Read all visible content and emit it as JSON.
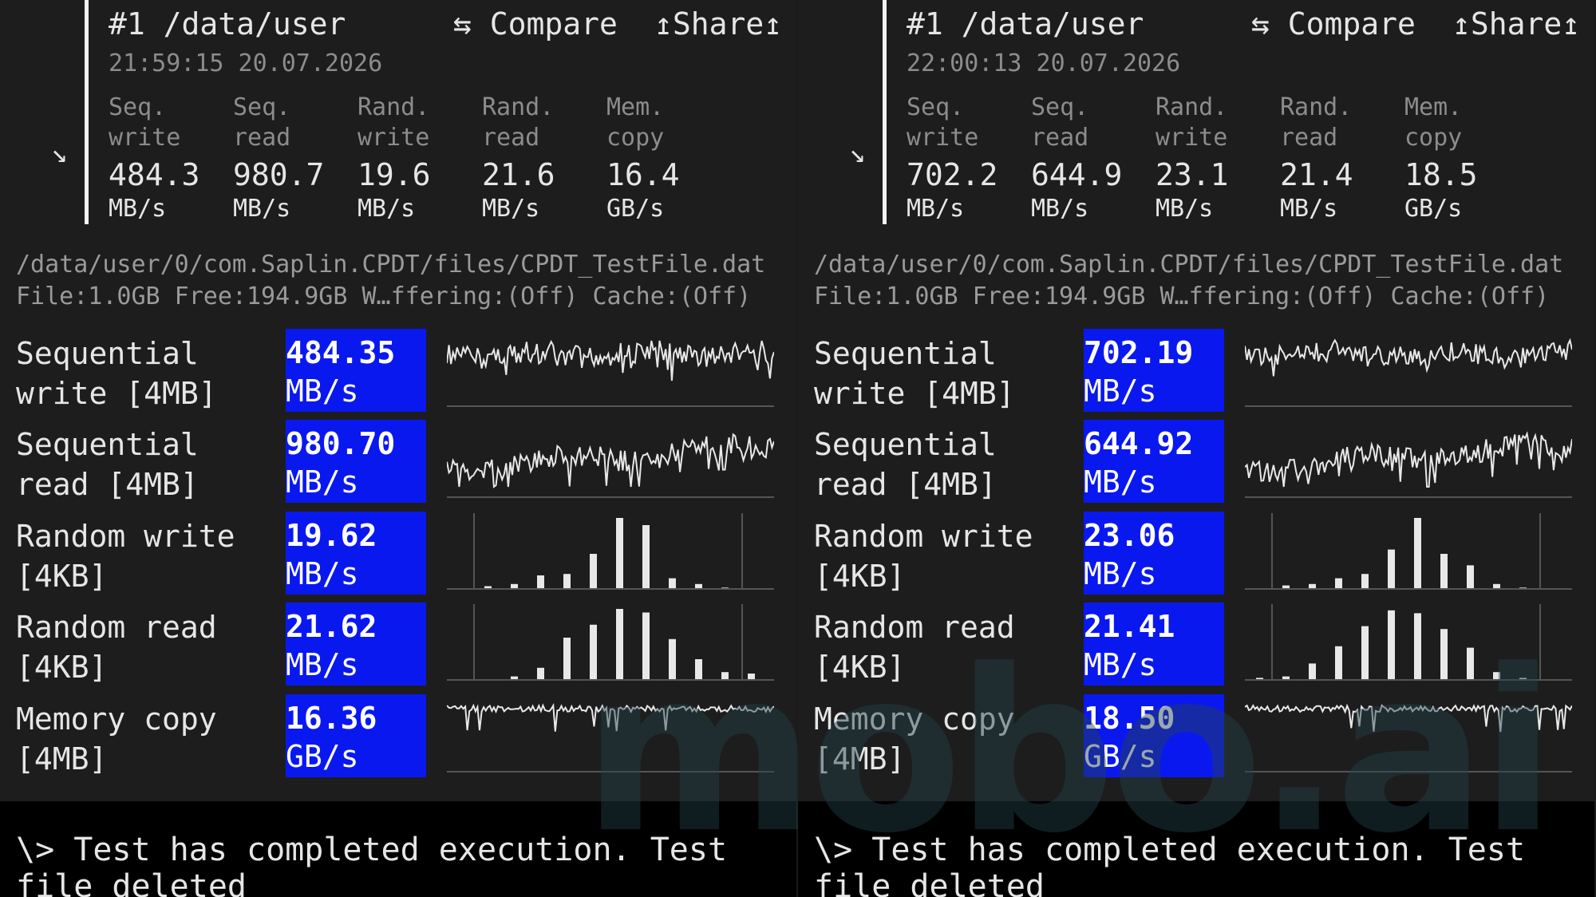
{
  "colors": {
    "value_box": "#0a18f0",
    "background": "#1d1d1d",
    "status_background": "#000000"
  },
  "icons": {
    "arrow": "arrow-down-right-icon",
    "compare": "swap-icon",
    "share": "share-icon"
  },
  "watermark": "mobo.ai",
  "panels": [
    {
      "title": "#1 /data/user",
      "compare_label": "⇆ Compare",
      "share_label": "↥Share↥",
      "timestamp": "21:59:15 20.07.2026",
      "arrow": "↘",
      "metrics": [
        {
          "l1": "Seq.",
          "l2": "write",
          "value": "484.3",
          "unit": "MB/s"
        },
        {
          "l1": "Seq.",
          "l2": "read",
          "value": "980.7",
          "unit": "MB/s"
        },
        {
          "l1": "Rand.",
          "l2": "write",
          "value": "19.6",
          "unit": "MB/s"
        },
        {
          "l1": "Rand.",
          "l2": "read",
          "value": "21.6",
          "unit": "MB/s"
        },
        {
          "l1": "Mem.",
          "l2": "copy",
          "value": "16.4",
          "unit": "GB/s"
        }
      ],
      "path": "/data/user/0/com.Saplin.CPDT/files/CPDT_TestFile.dat",
      "info": "File:1.0GB Free:194.9GB W…ffering:(Off) Cache:(Off)",
      "results": [
        {
          "label": "Sequential\nwrite [4MB]",
          "value": "484.35",
          "unit": "MB/s",
          "graph": "line"
        },
        {
          "label": "Sequential\nread [4MB]",
          "value": "980.70",
          "unit": "MB/s",
          "graph": "line"
        },
        {
          "label": "Random write\n[4KB]",
          "value": "19.62",
          "unit": "MB/s",
          "graph": "bars"
        },
        {
          "label": "Random read\n[4KB]",
          "value": "21.62",
          "unit": "MB/s",
          "graph": "bars"
        },
        {
          "label": "Memory copy\n[4MB]",
          "value": "16.36",
          "unit": "GB/s",
          "graph": "line"
        }
      ],
      "status": "\\> Test has completed execution. Test file deleted"
    },
    {
      "title": "#1 /data/user",
      "compare_label": "⇆ Compare",
      "share_label": "↥Share↥",
      "timestamp": "22:00:13 20.07.2026",
      "arrow": "↘",
      "metrics": [
        {
          "l1": "Seq.",
          "l2": "write",
          "value": "702.2",
          "unit": "MB/s"
        },
        {
          "l1": "Seq.",
          "l2": "read",
          "value": "644.9",
          "unit": "MB/s"
        },
        {
          "l1": "Rand.",
          "l2": "write",
          "value": "23.1",
          "unit": "MB/s"
        },
        {
          "l1": "Rand.",
          "l2": "read",
          "value": "21.4",
          "unit": "MB/s"
        },
        {
          "l1": "Mem.",
          "l2": "copy",
          "value": "18.5",
          "unit": "GB/s"
        }
      ],
      "path": "/data/user/0/com.Saplin.CPDT/files/CPDT_TestFile.dat",
      "info": "File:1.0GB Free:194.9GB W…ffering:(Off) Cache:(Off)",
      "results": [
        {
          "label": "Sequential\nwrite [4MB]",
          "value": "702.19",
          "unit": "MB/s",
          "graph": "line"
        },
        {
          "label": "Sequential\nread [4MB]",
          "value": "644.92",
          "unit": "MB/s",
          "graph": "line"
        },
        {
          "label": "Random write\n[4KB]",
          "value": "23.06",
          "unit": "MB/s",
          "graph": "bars"
        },
        {
          "label": "Random read\n[4KB]",
          "value": "21.41",
          "unit": "MB/s",
          "graph": "bars"
        },
        {
          "label": "Memory copy\n[4MB]",
          "value": "18.50",
          "unit": "GB/s",
          "graph": "line"
        }
      ],
      "status": "\\> Test has completed execution. Test file deleted"
    }
  ]
}
